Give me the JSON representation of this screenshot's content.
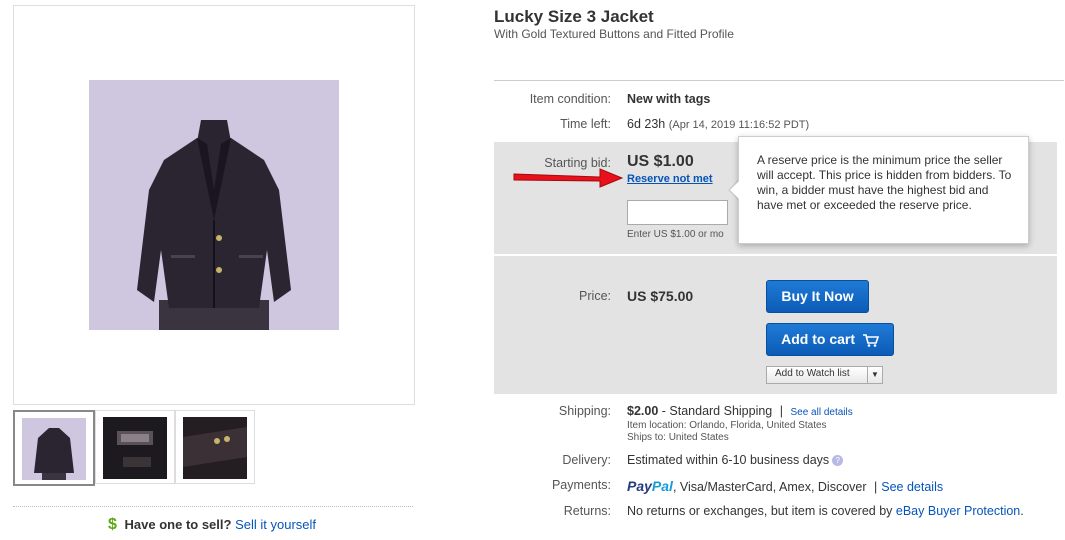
{
  "title": "Lucky Size 3 Jacket",
  "subtitle": "With Gold Textured Buttons and Fitted Profile",
  "condition": {
    "label": "Item condition:",
    "value": "New with tags"
  },
  "time_left": {
    "label": "Time left:",
    "value": "6d 23h",
    "end": "(Apr 14, 2019 11:16:52 PDT)"
  },
  "bid": {
    "label": "Starting bid:",
    "value": "US $1.00",
    "reserve_link": "Reserve not met",
    "hint": "Enter US $1.00 or mo",
    "input_value": ""
  },
  "tooltip": {
    "text": "A reserve price is the minimum price the seller will accept. This price is hidden from bidders. To win, a bidder must have the highest bid and have met or exceeded the reserve price."
  },
  "price": {
    "label": "Price:",
    "value": "US $75.00"
  },
  "buttons": {
    "buy_now": "Buy It Now",
    "add_to_cart": "Add to cart",
    "watch_list": "Add to Watch list"
  },
  "shipping": {
    "label": "Shipping:",
    "cost": "$2.00",
    "method": "- Standard Shipping",
    "separator": "|",
    "see_all": "See all details",
    "location": "Item location: Orlando, Florida, United States",
    "ships_to": "Ships to: United States"
  },
  "delivery": {
    "label": "Delivery:",
    "value": "Estimated within 6-10 business days"
  },
  "payments": {
    "label": "Payments:",
    "paypal_a": "Pay",
    "paypal_b": "Pal",
    "others": ", Visa/MasterCard, Amex, Discover",
    "separator": "|",
    "see_details": "See details"
  },
  "returns": {
    "label": "Returns:",
    "text": "No returns or exchanges, but item is covered by ",
    "link": "eBay Buyer Protection",
    "end": "."
  },
  "sell": {
    "question": "Have one to sell?",
    "link": "Sell it yourself",
    "icon": "$"
  },
  "colors": {
    "accent": "#0654ba",
    "button": "#0b5cb6",
    "panel": "#e3e3e3",
    "sell_icon": "#5ba812",
    "arrow": "#e8101a"
  }
}
